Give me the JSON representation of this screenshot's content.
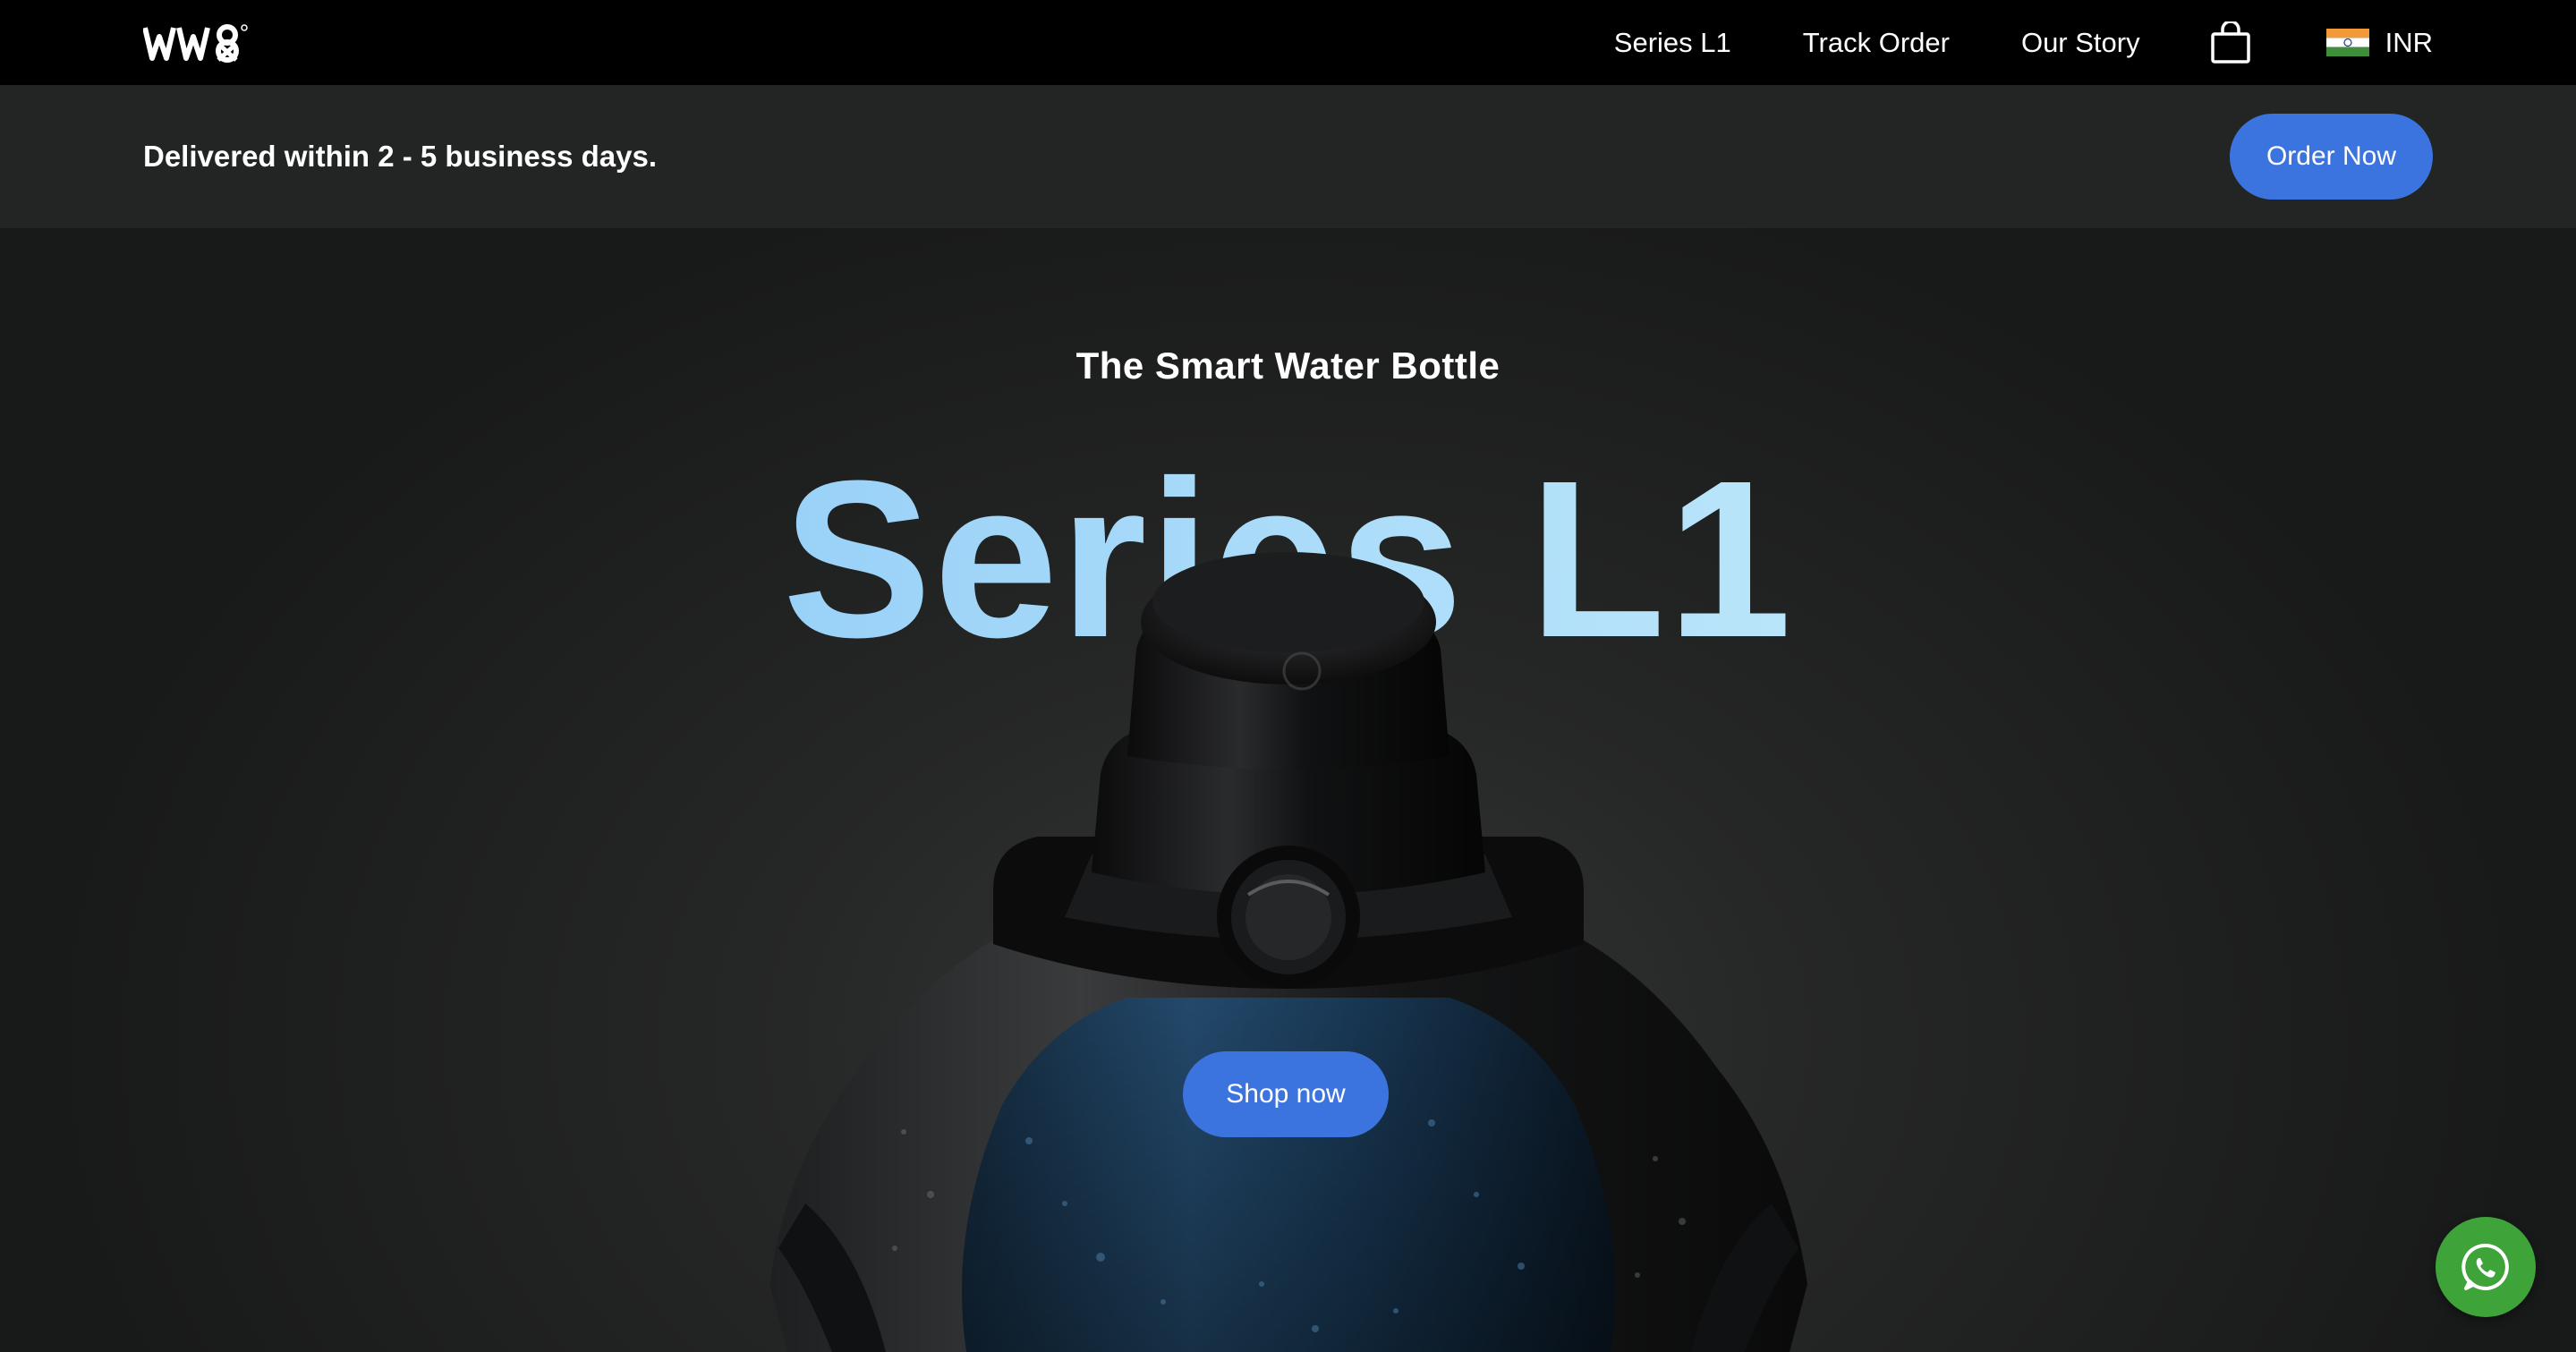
{
  "nav": {
    "logo_text": "LWI8",
    "links": [
      "Series L1",
      "Track Order",
      "Our Story"
    ],
    "cart_icon": "shopping-bag-icon",
    "currency": {
      "flag_icon": "india-flag-icon",
      "label": "INR"
    }
  },
  "announcement": {
    "text": "Delivered within 2 - 5 business days.",
    "button_label": "Order Now"
  },
  "hero": {
    "subtitle": "The Smart Water Bottle",
    "title": "Series L1",
    "button_label": "Shop now",
    "image": "smart-water-bottle-image"
  },
  "floating": {
    "chat_icon": "whatsapp-icon"
  },
  "colors": {
    "accent": "#3c74df",
    "title_gradient": [
      "#7fc0f6",
      "#d2f4fb"
    ],
    "whatsapp": "#3ea43a",
    "navbar": "#000000",
    "announcement_bg": "#232424"
  }
}
